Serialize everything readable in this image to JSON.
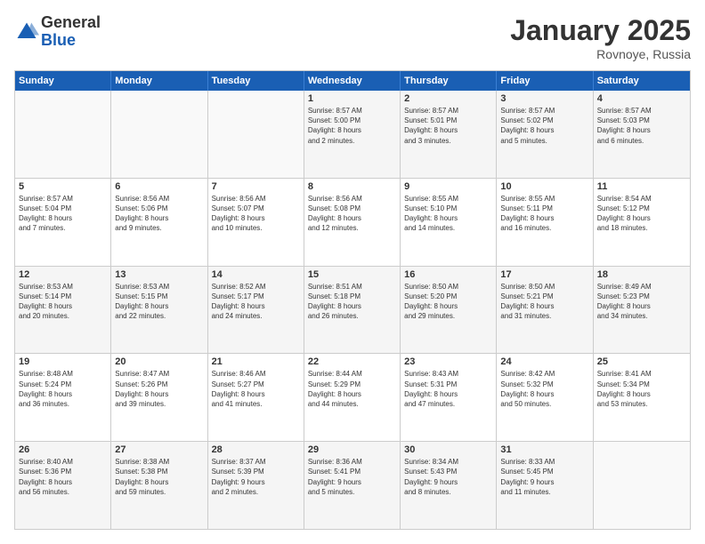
{
  "logo": {
    "general": "General",
    "blue": "Blue"
  },
  "title": "January 2025",
  "location": "Rovnoye, Russia",
  "days": [
    "Sunday",
    "Monday",
    "Tuesday",
    "Wednesday",
    "Thursday",
    "Friday",
    "Saturday"
  ],
  "rows": [
    [
      {
        "day": "",
        "lines": []
      },
      {
        "day": "",
        "lines": []
      },
      {
        "day": "",
        "lines": []
      },
      {
        "day": "1",
        "lines": [
          "Sunrise: 8:57 AM",
          "Sunset: 5:00 PM",
          "Daylight: 8 hours",
          "and 2 minutes."
        ]
      },
      {
        "day": "2",
        "lines": [
          "Sunrise: 8:57 AM",
          "Sunset: 5:01 PM",
          "Daylight: 8 hours",
          "and 3 minutes."
        ]
      },
      {
        "day": "3",
        "lines": [
          "Sunrise: 8:57 AM",
          "Sunset: 5:02 PM",
          "Daylight: 8 hours",
          "and 5 minutes."
        ]
      },
      {
        "day": "4",
        "lines": [
          "Sunrise: 8:57 AM",
          "Sunset: 5:03 PM",
          "Daylight: 8 hours",
          "and 6 minutes."
        ]
      }
    ],
    [
      {
        "day": "5",
        "lines": [
          "Sunrise: 8:57 AM",
          "Sunset: 5:04 PM",
          "Daylight: 8 hours",
          "and 7 minutes."
        ]
      },
      {
        "day": "6",
        "lines": [
          "Sunrise: 8:56 AM",
          "Sunset: 5:06 PM",
          "Daylight: 8 hours",
          "and 9 minutes."
        ]
      },
      {
        "day": "7",
        "lines": [
          "Sunrise: 8:56 AM",
          "Sunset: 5:07 PM",
          "Daylight: 8 hours",
          "and 10 minutes."
        ]
      },
      {
        "day": "8",
        "lines": [
          "Sunrise: 8:56 AM",
          "Sunset: 5:08 PM",
          "Daylight: 8 hours",
          "and 12 minutes."
        ]
      },
      {
        "day": "9",
        "lines": [
          "Sunrise: 8:55 AM",
          "Sunset: 5:10 PM",
          "Daylight: 8 hours",
          "and 14 minutes."
        ]
      },
      {
        "day": "10",
        "lines": [
          "Sunrise: 8:55 AM",
          "Sunset: 5:11 PM",
          "Daylight: 8 hours",
          "and 16 minutes."
        ]
      },
      {
        "day": "11",
        "lines": [
          "Sunrise: 8:54 AM",
          "Sunset: 5:12 PM",
          "Daylight: 8 hours",
          "and 18 minutes."
        ]
      }
    ],
    [
      {
        "day": "12",
        "lines": [
          "Sunrise: 8:53 AM",
          "Sunset: 5:14 PM",
          "Daylight: 8 hours",
          "and 20 minutes."
        ]
      },
      {
        "day": "13",
        "lines": [
          "Sunrise: 8:53 AM",
          "Sunset: 5:15 PM",
          "Daylight: 8 hours",
          "and 22 minutes."
        ]
      },
      {
        "day": "14",
        "lines": [
          "Sunrise: 8:52 AM",
          "Sunset: 5:17 PM",
          "Daylight: 8 hours",
          "and 24 minutes."
        ]
      },
      {
        "day": "15",
        "lines": [
          "Sunrise: 8:51 AM",
          "Sunset: 5:18 PM",
          "Daylight: 8 hours",
          "and 26 minutes."
        ]
      },
      {
        "day": "16",
        "lines": [
          "Sunrise: 8:50 AM",
          "Sunset: 5:20 PM",
          "Daylight: 8 hours",
          "and 29 minutes."
        ]
      },
      {
        "day": "17",
        "lines": [
          "Sunrise: 8:50 AM",
          "Sunset: 5:21 PM",
          "Daylight: 8 hours",
          "and 31 minutes."
        ]
      },
      {
        "day": "18",
        "lines": [
          "Sunrise: 8:49 AM",
          "Sunset: 5:23 PM",
          "Daylight: 8 hours",
          "and 34 minutes."
        ]
      }
    ],
    [
      {
        "day": "19",
        "lines": [
          "Sunrise: 8:48 AM",
          "Sunset: 5:24 PM",
          "Daylight: 8 hours",
          "and 36 minutes."
        ]
      },
      {
        "day": "20",
        "lines": [
          "Sunrise: 8:47 AM",
          "Sunset: 5:26 PM",
          "Daylight: 8 hours",
          "and 39 minutes."
        ]
      },
      {
        "day": "21",
        "lines": [
          "Sunrise: 8:46 AM",
          "Sunset: 5:27 PM",
          "Daylight: 8 hours",
          "and 41 minutes."
        ]
      },
      {
        "day": "22",
        "lines": [
          "Sunrise: 8:44 AM",
          "Sunset: 5:29 PM",
          "Daylight: 8 hours",
          "and 44 minutes."
        ]
      },
      {
        "day": "23",
        "lines": [
          "Sunrise: 8:43 AM",
          "Sunset: 5:31 PM",
          "Daylight: 8 hours",
          "and 47 minutes."
        ]
      },
      {
        "day": "24",
        "lines": [
          "Sunrise: 8:42 AM",
          "Sunset: 5:32 PM",
          "Daylight: 8 hours",
          "and 50 minutes."
        ]
      },
      {
        "day": "25",
        "lines": [
          "Sunrise: 8:41 AM",
          "Sunset: 5:34 PM",
          "Daylight: 8 hours",
          "and 53 minutes."
        ]
      }
    ],
    [
      {
        "day": "26",
        "lines": [
          "Sunrise: 8:40 AM",
          "Sunset: 5:36 PM",
          "Daylight: 8 hours",
          "and 56 minutes."
        ]
      },
      {
        "day": "27",
        "lines": [
          "Sunrise: 8:38 AM",
          "Sunset: 5:38 PM",
          "Daylight: 8 hours",
          "and 59 minutes."
        ]
      },
      {
        "day": "28",
        "lines": [
          "Sunrise: 8:37 AM",
          "Sunset: 5:39 PM",
          "Daylight: 9 hours",
          "and 2 minutes."
        ]
      },
      {
        "day": "29",
        "lines": [
          "Sunrise: 8:36 AM",
          "Sunset: 5:41 PM",
          "Daylight: 9 hours",
          "and 5 minutes."
        ]
      },
      {
        "day": "30",
        "lines": [
          "Sunrise: 8:34 AM",
          "Sunset: 5:43 PM",
          "Daylight: 9 hours",
          "and 8 minutes."
        ]
      },
      {
        "day": "31",
        "lines": [
          "Sunrise: 8:33 AM",
          "Sunset: 5:45 PM",
          "Daylight: 9 hours",
          "and 11 minutes."
        ]
      },
      {
        "day": "",
        "lines": []
      }
    ]
  ],
  "alt_rows": [
    0,
    2,
    4
  ],
  "colors": {
    "header_bg": "#1a5fb4",
    "header_text": "#ffffff",
    "alt_bg": "#f0f0f0"
  }
}
